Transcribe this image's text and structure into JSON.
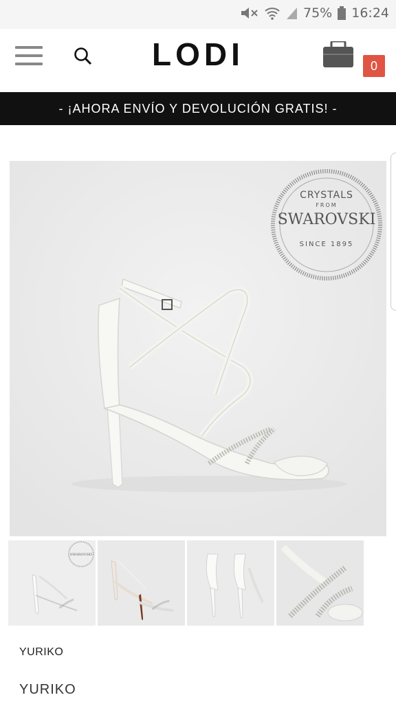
{
  "status_bar": {
    "battery": "75%",
    "time": "16:24"
  },
  "header": {
    "logo": "LODI",
    "cart_count": "0"
  },
  "promo": {
    "text": "- ¡AHORA ENVÍO Y DEVOLUCIÓN GRATIS! -"
  },
  "badge": {
    "line1": "CRYSTALS",
    "line2": "FROM",
    "line3": "SWAROVSKI",
    "line4": "SINCE 1895"
  },
  "product": {
    "title": "YURIKO",
    "name": "YURIKO"
  },
  "icons": [
    "menu-icon",
    "search-icon",
    "cart-icon",
    "wifi-icon",
    "signal-icon",
    "battery-icon",
    "mute-icon"
  ]
}
